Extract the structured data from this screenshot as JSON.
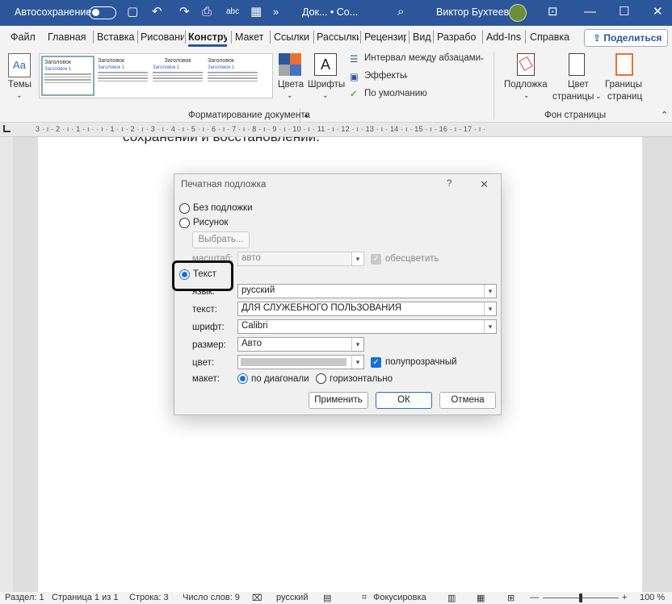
{
  "titlebar": {
    "autosave_label": "Автосохранение",
    "doc_title": "Док... • Со...",
    "user_name": "Виктор Бухтеев"
  },
  "tabs": [
    "Файл",
    "Главная",
    "Вставка",
    "Рисовани",
    "Конструктор",
    "Макет",
    "Ссылки",
    "Рассылки",
    "Рецензир",
    "Вид",
    "Разрабо",
    "Add-Ins",
    "Справка"
  ],
  "share_label": "Поделиться",
  "ribbon": {
    "themes_label": "Темы",
    "gallery_items": [
      {
        "h": "Заголовок",
        "h2": "Заголовок 1"
      },
      {
        "h": "Заголовок",
        "h2": "Заголовок 1"
      },
      {
        "h": "Заголовок",
        "h2": "Заголовок 1"
      },
      {
        "h": "Заголовок",
        "h2": "Заголовок 1"
      }
    ],
    "colors_label": "Цвета",
    "fonts_label": "Шрифты",
    "spacing_label": "Интервал между абзацами",
    "effects_label": "Эффекты",
    "default_label": "По умолчанию",
    "group_format": "Форматирование документа",
    "watermark_label": "Подложка",
    "page_color_label1": "Цвет",
    "page_color_label2": "страницы",
    "page_borders_label1": "Границы",
    "page_borders_label2": "страниц",
    "group_page_bg": "Фон страницы"
  },
  "ruler_text": "3 · ı · 2 · ı · 1 · ı ·   · ı · 1 · ı · 2 · ı · 3 · ı · 4 · ı · 5 · ı · 6 · ı · 7 · ı · 8 · ı · 9 · ı · 10 · ı · 11 · ı · 12 · ı · 13 · ı · 14 · ı · 15 · ı · 16 · ı · 17 · ı ·",
  "page_text": "сохранении и восстановлении.",
  "dialog": {
    "title": "Печатная подложка",
    "help": "?",
    "close": "✕",
    "no_watermark": "Без подложки",
    "picture": "Рисунок",
    "select_button": "Выбрать...",
    "scale_label": "масштаб:",
    "scale_value": "авто",
    "washout_label": "обесцветить",
    "text_option": "Текст",
    "lang_label": "язык:",
    "lang_value": "русский",
    "text_label": "текст:",
    "text_value": "ДЛЯ СЛУЖЕБНОГО ПОЛЬЗОВАНИЯ",
    "font_label": "шрифт:",
    "font_value": "Calibri",
    "size_label": "размер:",
    "size_value": "Авто",
    "color_label": "цвет:",
    "semitransparent_label": "полупрозрачный",
    "layout_label": "макет:",
    "diagonal_label": "по диагонали",
    "horizontal_label": "горизонтально",
    "apply_button": "Применить",
    "ok_button": "ОК",
    "cancel_button": "Отмена"
  },
  "status": {
    "section": "Раздел: 1",
    "page": "Страница 1 из 1",
    "line": "Строка: 3",
    "words": "Число слов: 9",
    "language": "русский",
    "focus": "Фокусировка",
    "zoom": "100 %"
  },
  "colors": {
    "accent": "#2b579a",
    "highlight": "#111111",
    "radio_on": "#1a6fd6"
  }
}
